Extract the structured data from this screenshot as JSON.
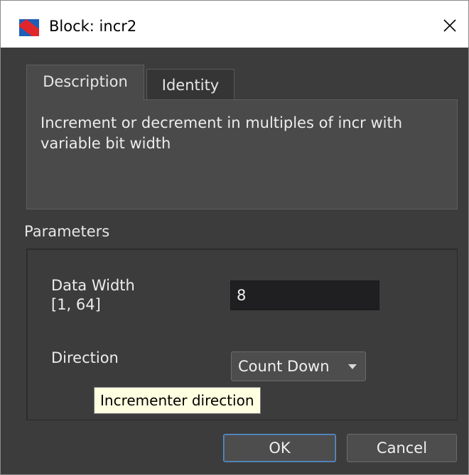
{
  "window": {
    "title": "Block: incr2",
    "app_icon": "block-editor-icon",
    "close_icon": "close-icon"
  },
  "tabs": [
    {
      "label": "Description",
      "active": true
    },
    {
      "label": "Identity",
      "active": false
    }
  ],
  "description": {
    "text": "Increment or decrement in multiples of incr with variable bit width"
  },
  "parameters": {
    "section_label": "Parameters",
    "data_width": {
      "label": "Data Width\n[1, 64]",
      "value": "8"
    },
    "direction": {
      "label": "Direction",
      "selected": "Count Down"
    },
    "tooltip": "Incrementer direction"
  },
  "buttons": {
    "ok": "OK",
    "cancel": "Cancel"
  },
  "colors": {
    "background": "#3c3c3c",
    "panel": "#4a4a4a",
    "accent_focus": "#5a8fc7",
    "icon_blue": "#1e5eb8",
    "icon_red": "#e0262b"
  }
}
